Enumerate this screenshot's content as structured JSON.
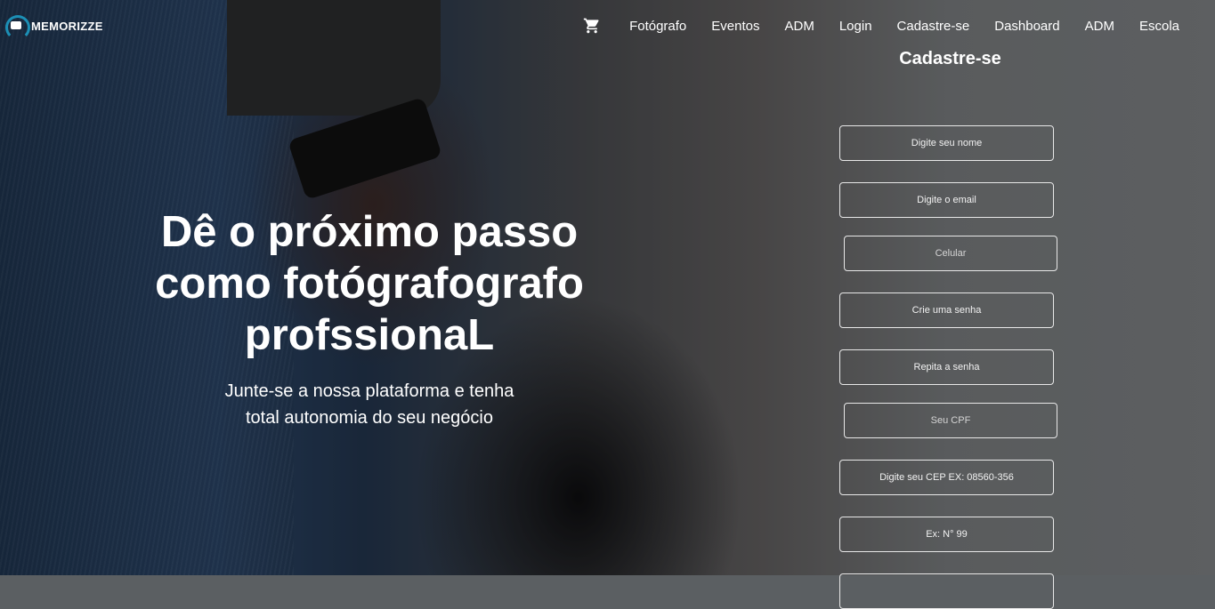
{
  "brand": {
    "name": "MEMORIZZE",
    "accent": "#1c8fb5"
  },
  "nav": {
    "cart_icon": "cart-icon",
    "items": [
      "Fotógrafo",
      "Eventos",
      "ADM",
      "Login",
      "Cadastre-se",
      "Dashboard",
      "ADM",
      "Escola"
    ]
  },
  "hero": {
    "title": "Dê o próximo passo como fotógrafografo profssionaL",
    "subtitle": "Junte-se a nossa plataforma e tenha total autonomia do seu negócio"
  },
  "form": {
    "title": "Cadastre-se",
    "fields": {
      "nome": "Digite seu nome",
      "email": "Digite o email",
      "celular": "Celular",
      "senha": "Crie uma senha",
      "repita": "Repita a senha",
      "cpf": "Seu CPF",
      "cep": "Digite seu CEP EX: 08560-356",
      "numero": "Ex: N° 99"
    }
  }
}
